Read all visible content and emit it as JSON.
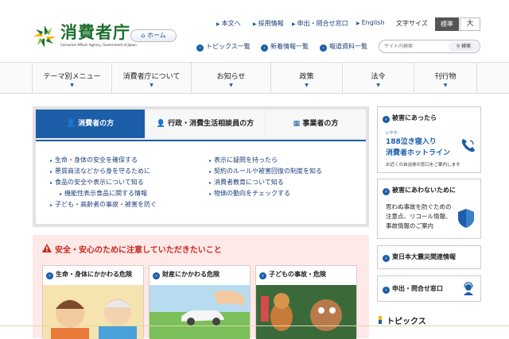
{
  "header": {
    "logo": {
      "title": "消費者庁",
      "subtitle": "Consumer Affairs Agency, Government of Japan"
    },
    "home_label": "ホーム",
    "util_links": [
      "本文へ",
      "採用情報",
      "申出・問合せ窓口",
      "English"
    ],
    "font_size": {
      "label": "文字サイズ",
      "standard": "標準",
      "large": "大"
    },
    "secondary_links": [
      "トピックス一覧",
      "新着情報一覧",
      "報道資料一覧"
    ],
    "search": {
      "placeholder": "サイト内検索",
      "button": "検索"
    }
  },
  "global_nav": [
    "テーマ別メニュー",
    "消費者庁について",
    "お知らせ",
    "政策",
    "法令",
    "刊行物"
  ],
  "tabs": {
    "items": [
      "消費者の方",
      "行政・消費生活相談員の方",
      "事業者の方"
    ],
    "links_left": [
      "生命・身体の安全を確保する",
      "悪質商法などから身を守るために",
      "食品の安全や表示について知る",
      "機能性表示食品に関する情報",
      "子ども・高齢者の事故・被害を防ぐ"
    ],
    "links_right": [
      "表示に疑問を持ったら",
      "契約のルールや被害回復の制度を知る",
      "消費者教育について知る",
      "物価の動向をチェックする"
    ]
  },
  "alert": {
    "title": "安全・安心のために注意していただきたいこと",
    "cards": [
      "生命・身体にかかわる危険",
      "財産にかかわる危険",
      "子どもの事故・危険"
    ]
  },
  "sidebar": {
    "hotline": {
      "heading": "被害にあったら",
      "ruby": "いやや",
      "line1": "188泣き寝入り",
      "line2": "消費者ホットライン",
      "note": "お近くの自治体の窓口をご案内します"
    },
    "prevent": {
      "heading": "被害にあわないために",
      "body": [
        "思わぬ事故を防ぐための",
        "注意点、リコール情報、",
        "事故情報のご案内"
      ]
    },
    "earthquake": "東日本大震災関連情報",
    "contact": "申出・問合せ窓口"
  },
  "topics_heading": "トピックス"
}
